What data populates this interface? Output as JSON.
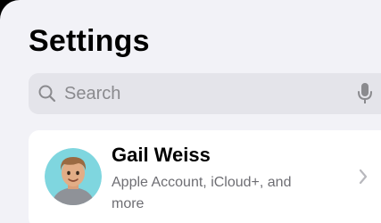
{
  "header": {
    "title": "Settings"
  },
  "search": {
    "placeholder": "Search",
    "icon": "search-icon",
    "trailing_icon": "microphone-icon"
  },
  "account": {
    "name": "Gail Weiss",
    "subtitle": "Apple Account, iCloud+, and more",
    "avatar": "memoji-avatar",
    "trailing_icon": "chevron-right-icon"
  },
  "colors": {
    "background": "#f2f2f7",
    "search_fill": "#e4e4ea",
    "card": "#ffffff",
    "secondary_text": "#6e6e73",
    "avatar_background": "#7fd6df"
  }
}
